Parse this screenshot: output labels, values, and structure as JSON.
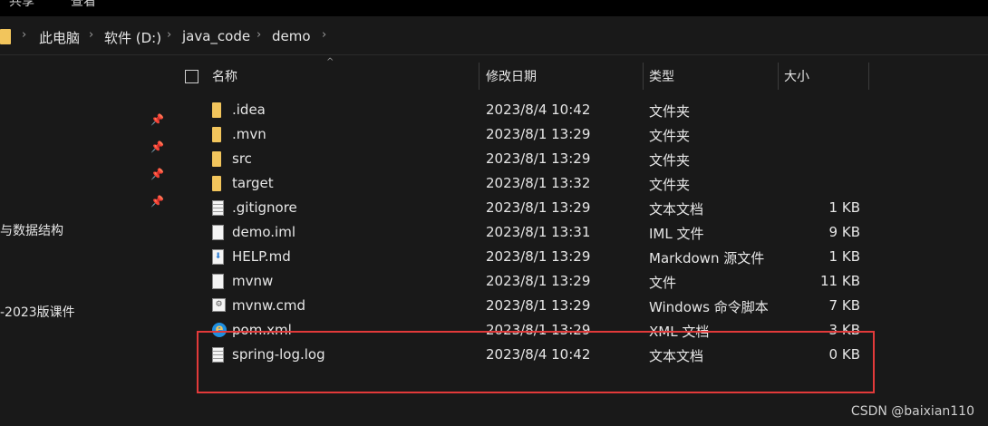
{
  "ribbon": {
    "tabs": [
      "共享",
      "查看"
    ]
  },
  "address": {
    "crumbs": [
      "此电脑",
      "软件 (D:)",
      "java_code",
      "demo"
    ]
  },
  "nav": {
    "items": [
      "与数据结构",
      "-2023版课件"
    ]
  },
  "columns": {
    "name": "名称",
    "date": "修改日期",
    "type": "类型",
    "size": "大小"
  },
  "files": [
    {
      "icon": "folder-icon",
      "name": ".idea",
      "date": "2023/8/4 10:42",
      "type": "文件夹",
      "size": ""
    },
    {
      "icon": "folder-icon",
      "name": ".mvn",
      "date": "2023/8/1 13:29",
      "type": "文件夹",
      "size": ""
    },
    {
      "icon": "folder-icon",
      "name": "src",
      "date": "2023/8/1 13:29",
      "type": "文件夹",
      "size": ""
    },
    {
      "icon": "folder-icon",
      "name": "target",
      "date": "2023/8/1 13:32",
      "type": "文件夹",
      "size": ""
    },
    {
      "icon": "text-file-icon",
      "name": ".gitignore",
      "date": "2023/8/1 13:29",
      "type": "文本文档",
      "size": "1 KB"
    },
    {
      "icon": "file-icon",
      "name": "demo.iml",
      "date": "2023/8/1 13:31",
      "type": "IML 文件",
      "size": "9 KB"
    },
    {
      "icon": "markdown-file-icon",
      "name": "HELP.md",
      "date": "2023/8/1 13:29",
      "type": "Markdown 源文件",
      "size": "1 KB"
    },
    {
      "icon": "file-icon",
      "name": "mvnw",
      "date": "2023/8/1 13:29",
      "type": "文件",
      "size": "11 KB"
    },
    {
      "icon": "cmd-file-icon",
      "name": "mvnw.cmd",
      "date": "2023/8/1 13:29",
      "type": "Windows 命令脚本",
      "size": "7 KB"
    },
    {
      "icon": "xml-ie-icon",
      "name": "pom.xml",
      "date": "2023/8/1 13:29",
      "type": "XML 文档",
      "size": "3 KB"
    },
    {
      "icon": "text-file-icon",
      "name": "spring-log.log",
      "date": "2023/8/4 10:42",
      "type": "文本文档",
      "size": "0 KB"
    }
  ],
  "watermark": "CSDN @baixian110",
  "colors": {
    "background": "#191919",
    "folder": "#f2c55c",
    "highlight": "#e23a3a"
  }
}
